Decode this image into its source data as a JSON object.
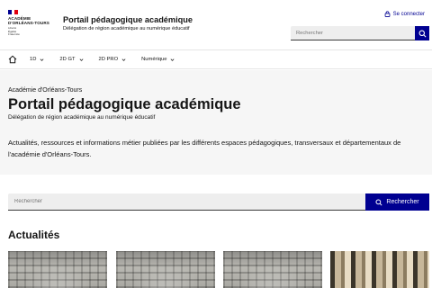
{
  "header": {
    "logo": {
      "line1": "ACADÉMIE",
      "line2": "D'ORLÉANS-TOURS",
      "motto": [
        "Liberté",
        "Égalité",
        "Fraternité"
      ]
    },
    "site_title": "Portail pédagogique académique",
    "site_subtitle": "Délégation de région académique au numérique éducatif",
    "login_label": "Se connecter",
    "search_placeholder": "Rechercher"
  },
  "nav": {
    "home_icon": "home-icon",
    "items": [
      {
        "label": "1D"
      },
      {
        "label": "2D GT"
      },
      {
        "label": "2D PRO"
      },
      {
        "label": "Numérique"
      }
    ]
  },
  "hero": {
    "kicker": "Académie d'Orléans-Tours",
    "title": "Portail pédagogique académique",
    "subtitle": "Délégation de région académique au numérique éducatif",
    "description": "Actualités, ressources et informations métier publiées par les différents espaces pédagogiques, transversaux et départementaux de l'académie d'Orléans-Tours."
  },
  "main_search": {
    "placeholder": "Rechercher",
    "button_label": "Rechercher"
  },
  "news": {
    "section_title": "Actualités"
  },
  "colors": {
    "primary": "#000091",
    "hero_bg": "#f6f6f6",
    "flag_red": "#e1000f"
  }
}
